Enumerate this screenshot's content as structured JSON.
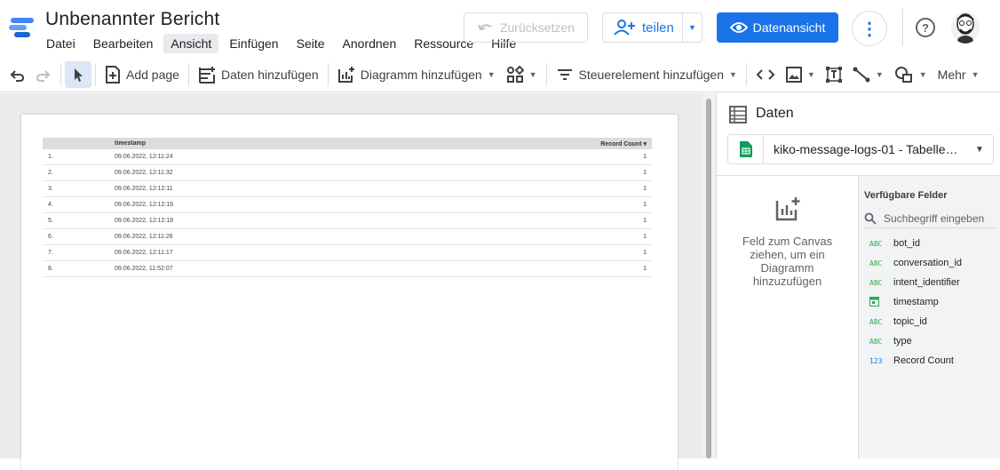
{
  "header": {
    "title": "Unbenannter Bericht",
    "menu": [
      "Datei",
      "Bearbeiten",
      "Ansicht",
      "Einfügen",
      "Seite",
      "Anordnen",
      "Ressource",
      "Hilfe"
    ],
    "active_menu": "Ansicht",
    "reset_label": "Zurücksetzen",
    "share_label": "teilen",
    "view_label": "Datenansicht",
    "more_symbol": "⋮",
    "help_symbol": "?"
  },
  "toolbar": {
    "add_page": "Add page",
    "add_data": "Daten hinzufügen",
    "add_chart": "Diagramm hinzufügen",
    "add_control": "Steuerelement hinzufügen",
    "more": "Mehr"
  },
  "table": {
    "headers": [
      "",
      "timestamp",
      "Record Count"
    ],
    "sort_symbol": "▾",
    "rows": [
      {
        "n": "1.",
        "ts": "09.06.2022, 12:11:24",
        "rc": "1"
      },
      {
        "n": "2.",
        "ts": "09.06.2022, 12:11:32",
        "rc": "1"
      },
      {
        "n": "3.",
        "ts": "09.06.2022, 12:12:11",
        "rc": "1"
      },
      {
        "n": "4.",
        "ts": "09.06.2022, 12:12:16",
        "rc": "1"
      },
      {
        "n": "5.",
        "ts": "09.06.2022, 12:12:18",
        "rc": "1"
      },
      {
        "n": "6.",
        "ts": "09.06.2022, 12:11:26",
        "rc": "1"
      },
      {
        "n": "7.",
        "ts": "09.06.2022, 12:11:17",
        "rc": "1"
      },
      {
        "n": "8.",
        "ts": "09.06.2022, 11:52:07",
        "rc": "1"
      }
    ]
  },
  "panel": {
    "title": "Daten",
    "datasource": "kiko-message-logs-01 - Tabelle…",
    "dropzone_text": "Feld zum Canvas ziehen, um ein Diagramm hinzuzufügen",
    "fields_header": "Verfügbare Felder",
    "search_placeholder": "Suchbegriff eingeben",
    "fields": [
      {
        "type": "ABC",
        "name": "bot_id"
      },
      {
        "type": "ABC",
        "name": "conversation_id"
      },
      {
        "type": "ABC",
        "name": "intent_identifier"
      },
      {
        "type": "date",
        "name": "timestamp"
      },
      {
        "type": "ABC",
        "name": "topic_id"
      },
      {
        "type": "ABC",
        "name": "type"
      },
      {
        "type": "123",
        "name": "Record Count"
      }
    ]
  },
  "colors": {
    "accent": "#1a73e8",
    "text_field": "#34a853",
    "number_field": "#1a73e8"
  }
}
